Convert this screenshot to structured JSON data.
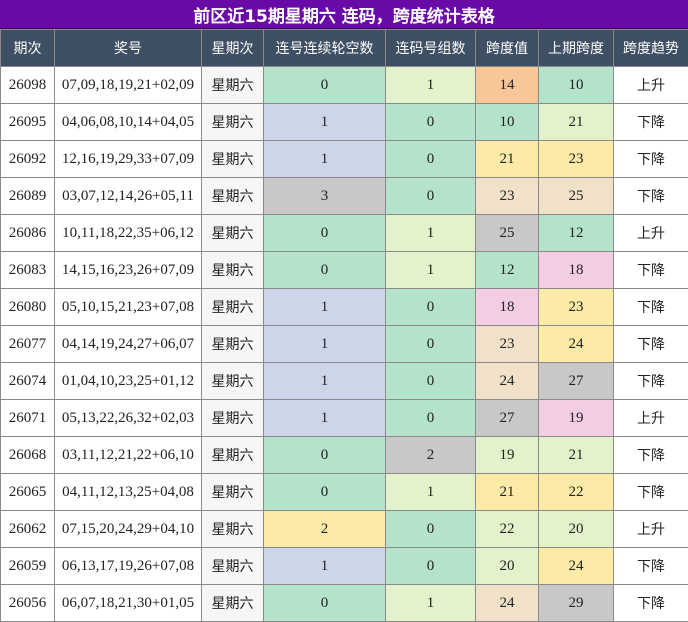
{
  "title": "前区近15期星期六 连码，跨度统计表格",
  "headers": [
    "期次",
    "奖号",
    "星期次",
    "连号连续轮空数",
    "连码号组数",
    "跨度值",
    "上期跨度",
    "跨度趋势"
  ],
  "colors": {
    "title_bg": "#6a0aa6",
    "header_bg": "#3f4f64",
    "mint": "#b5e2cb",
    "lightgreen": "#e4f2cb",
    "lavender": "#ccd6e8",
    "gray": "#c8c8c8",
    "yellow": "#fceba6",
    "peach": "#f7c79a",
    "beige": "#f0e1c8",
    "pink": "#f4cde4"
  },
  "rows": [
    {
      "period": "26098",
      "numbers": "07,09,18,19,21+02,09",
      "day": "星期六",
      "empty": "0",
      "empty_color": "mint",
      "groups": "1",
      "groups_color": "lightgreen",
      "span": "14",
      "span_color": "peach",
      "prev": "10",
      "prev_color": "mint",
      "trend": "上升"
    },
    {
      "period": "26095",
      "numbers": "04,06,08,10,14+04,05",
      "day": "星期六",
      "empty": "1",
      "empty_color": "lavender",
      "groups": "0",
      "groups_color": "mint",
      "span": "10",
      "span_color": "mint",
      "prev": "21",
      "prev_color": "lightgreen",
      "trend": "下降"
    },
    {
      "period": "26092",
      "numbers": "12,16,19,29,33+07,09",
      "day": "星期六",
      "empty": "1",
      "empty_color": "lavender",
      "groups": "0",
      "groups_color": "mint",
      "span": "21",
      "span_color": "yellow",
      "prev": "23",
      "prev_color": "yellow",
      "trend": "下降"
    },
    {
      "period": "26089",
      "numbers": "03,07,12,14,26+05,11",
      "day": "星期六",
      "empty": "3",
      "empty_color": "gray",
      "groups": "0",
      "groups_color": "mint",
      "span": "23",
      "span_color": "beige",
      "prev": "25",
      "prev_color": "beige",
      "trend": "下降"
    },
    {
      "period": "26086",
      "numbers": "10,11,18,22,35+06,12",
      "day": "星期六",
      "empty": "0",
      "empty_color": "mint",
      "groups": "1",
      "groups_color": "lightgreen",
      "span": "25",
      "span_color": "gray",
      "prev": "12",
      "prev_color": "mint",
      "trend": "上升"
    },
    {
      "period": "26083",
      "numbers": "14,15,16,23,26+07,09",
      "day": "星期六",
      "empty": "0",
      "empty_color": "mint",
      "groups": "1",
      "groups_color": "lightgreen",
      "span": "12",
      "span_color": "mint",
      "prev": "18",
      "prev_color": "pink",
      "trend": "下降"
    },
    {
      "period": "26080",
      "numbers": "05,10,15,21,23+07,08",
      "day": "星期六",
      "empty": "1",
      "empty_color": "lavender",
      "groups": "0",
      "groups_color": "mint",
      "span": "18",
      "span_color": "pink",
      "prev": "23",
      "prev_color": "yellow",
      "trend": "下降"
    },
    {
      "period": "26077",
      "numbers": "04,14,19,24,27+06,07",
      "day": "星期六",
      "empty": "1",
      "empty_color": "lavender",
      "groups": "0",
      "groups_color": "mint",
      "span": "23",
      "span_color": "beige",
      "prev": "24",
      "prev_color": "yellow",
      "trend": "下降"
    },
    {
      "period": "26074",
      "numbers": "01,04,10,23,25+01,12",
      "day": "星期六",
      "empty": "1",
      "empty_color": "lavender",
      "groups": "0",
      "groups_color": "mint",
      "span": "24",
      "span_color": "beige",
      "prev": "27",
      "prev_color": "gray",
      "trend": "下降"
    },
    {
      "period": "26071",
      "numbers": "05,13,22,26,32+02,03",
      "day": "星期六",
      "empty": "1",
      "empty_color": "lavender",
      "groups": "0",
      "groups_color": "mint",
      "span": "27",
      "span_color": "gray",
      "prev": "19",
      "prev_color": "pink",
      "trend": "上升"
    },
    {
      "period": "26068",
      "numbers": "03,11,12,21,22+06,10",
      "day": "星期六",
      "empty": "0",
      "empty_color": "mint",
      "groups": "2",
      "groups_color": "gray",
      "span": "19",
      "span_color": "lightgreen",
      "prev": "21",
      "prev_color": "lightgreen",
      "trend": "下降"
    },
    {
      "period": "26065",
      "numbers": "04,11,12,13,25+04,08",
      "day": "星期六",
      "empty": "0",
      "empty_color": "mint",
      "groups": "1",
      "groups_color": "lightgreen",
      "span": "21",
      "span_color": "yellow",
      "prev": "22",
      "prev_color": "yellow",
      "trend": "下降"
    },
    {
      "period": "26062",
      "numbers": "07,15,20,24,29+04,10",
      "day": "星期六",
      "empty": "2",
      "empty_color": "yellow",
      "groups": "0",
      "groups_color": "mint",
      "span": "22",
      "span_color": "lightgreen",
      "prev": "20",
      "prev_color": "lightgreen",
      "trend": "上升"
    },
    {
      "period": "26059",
      "numbers": "06,13,17,19,26+07,08",
      "day": "星期六",
      "empty": "1",
      "empty_color": "lavender",
      "groups": "0",
      "groups_color": "mint",
      "span": "20",
      "span_color": "lightgreen",
      "prev": "24",
      "prev_color": "yellow",
      "trend": "下降"
    },
    {
      "period": "26056",
      "numbers": "06,07,18,21,30+01,05",
      "day": "星期六",
      "empty": "0",
      "empty_color": "mint",
      "groups": "1",
      "groups_color": "lightgreen",
      "span": "24",
      "span_color": "beige",
      "prev": "29",
      "prev_color": "gray",
      "trend": "下降"
    }
  ]
}
